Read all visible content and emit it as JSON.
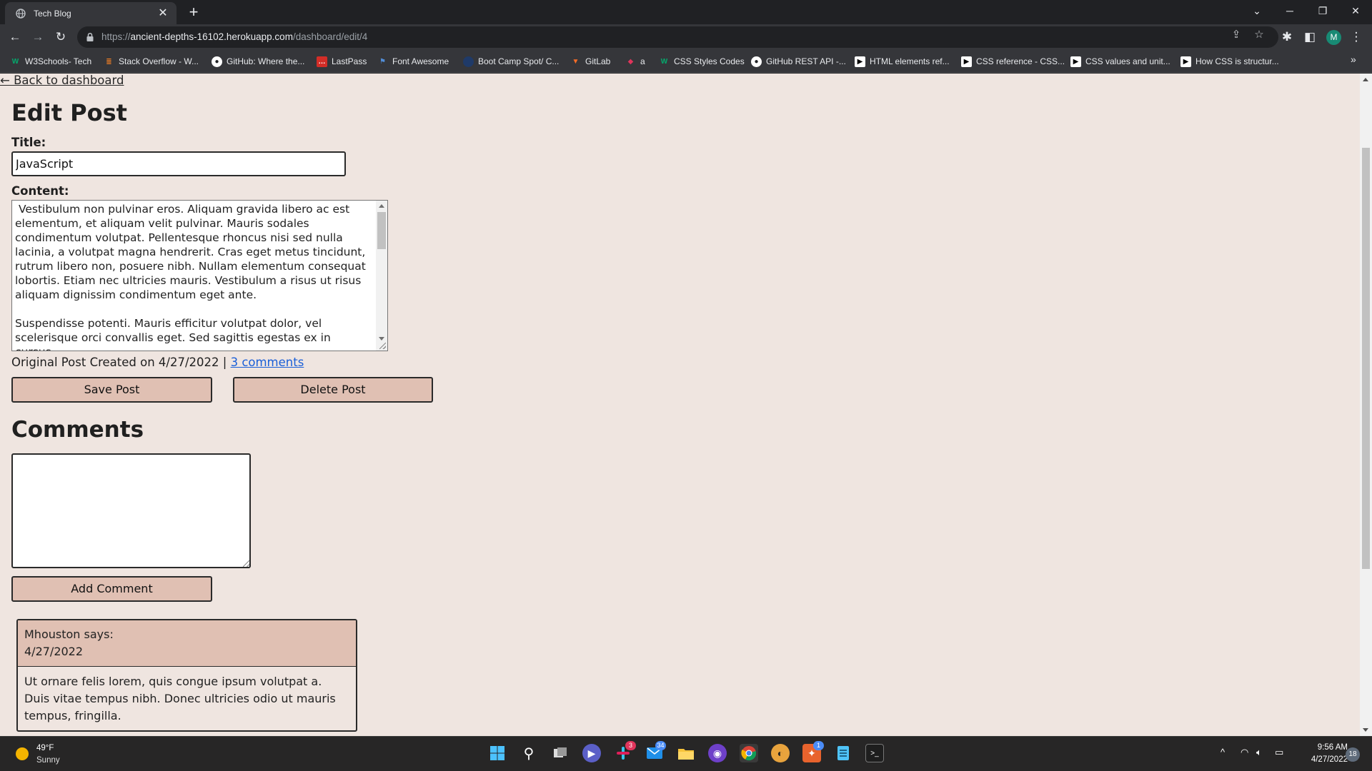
{
  "browser": {
    "tab_title": "Tech Blog",
    "url_scheme": "https://",
    "url_host": "ancient-depths-16102.herokuapp.com",
    "url_path": "/dashboard/edit/4",
    "profile_initial": "M",
    "bookmarks": [
      {
        "label": "W3Schools- Tech",
        "icon": "w3schools-icon",
        "color": "#04aa6d"
      },
      {
        "label": "Stack Overflow - W...",
        "icon": "stackoverflow-icon",
        "color": "#f48024"
      },
      {
        "label": "GitHub: Where the...",
        "icon": "github-icon",
        "color": "#ffffff"
      },
      {
        "label": "LastPass",
        "icon": "lastpass-icon",
        "color": "#d32d27"
      },
      {
        "label": "Font Awesome",
        "icon": "flag-icon",
        "color": "#528dd7"
      },
      {
        "label": "Boot Camp Spot/ C...",
        "icon": "bootcamp-icon",
        "color": "#1f3a68"
      },
      {
        "label": "GitLab",
        "icon": "gitlab-icon",
        "color": "#fc6d26"
      },
      {
        "label": "a",
        "icon": "bookmark-icon",
        "color": "#e0345b"
      },
      {
        "label": "CSS Styles Codes",
        "icon": "w3schools-icon",
        "color": "#04aa6d"
      },
      {
        "label": "GitHub REST API -...",
        "icon": "github-icon",
        "color": "#ffffff"
      },
      {
        "label": "HTML elements ref...",
        "icon": "mdn-icon",
        "color": "#ffffff"
      },
      {
        "label": "CSS reference - CSS...",
        "icon": "mdn-icon",
        "color": "#ffffff"
      },
      {
        "label": "CSS values and unit...",
        "icon": "mdn-icon",
        "color": "#ffffff"
      },
      {
        "label": "How CSS is structur...",
        "icon": "mdn-icon",
        "color": "#ffffff"
      }
    ]
  },
  "page": {
    "back_link": "← Back to dashboard",
    "heading": "Edit Post",
    "title_label": "Title:",
    "title_value": "JavaScript",
    "content_label": "Content:",
    "content_value": " Vestibulum non pulvinar eros. Aliquam gravida libero ac est elementum, et aliquam velit pulvinar. Mauris sodales condimentum volutpat. Pellentesque rhoncus nisi sed nulla lacinia, a volutpat magna hendrerit. Cras eget metus tincidunt, rutrum libero non, posuere nibh. Nullam elementum consequat lobortis. Etiam nec ultricies mauris. Vestibulum a risus ut risus aliquam dignissim condimentum eget ante.\n\nSuspendisse potenti. Mauris efficitur volutpat dolor, vel scelerisque orci convallis eget. Sed sagittis egestas ex in cursus.",
    "meta_text": "Original Post Created on 4/27/2022 | ",
    "comments_link": "3 comments",
    "save_button": "Save Post",
    "delete_button": "Delete Post",
    "comments_heading": "Comments",
    "comment_input_value": "",
    "add_comment_button": "Add Comment",
    "comments": [
      {
        "author_line": "Mhouston says:",
        "date": "4/27/2022",
        "text": "Ut ornare felis lorem, quis congue ipsum volutpat a. Duis vitae tempus nibh. Donec ultricies odio ut mauris tempus, fringilla."
      }
    ]
  },
  "taskbar": {
    "weather_temp": "49°F",
    "weather_condition": "Sunny",
    "time": "9:56 AM",
    "date": "4/27/2022",
    "notification_count": "18",
    "badge_slack": "3",
    "badge_mail": "34",
    "badge_app": "1"
  }
}
